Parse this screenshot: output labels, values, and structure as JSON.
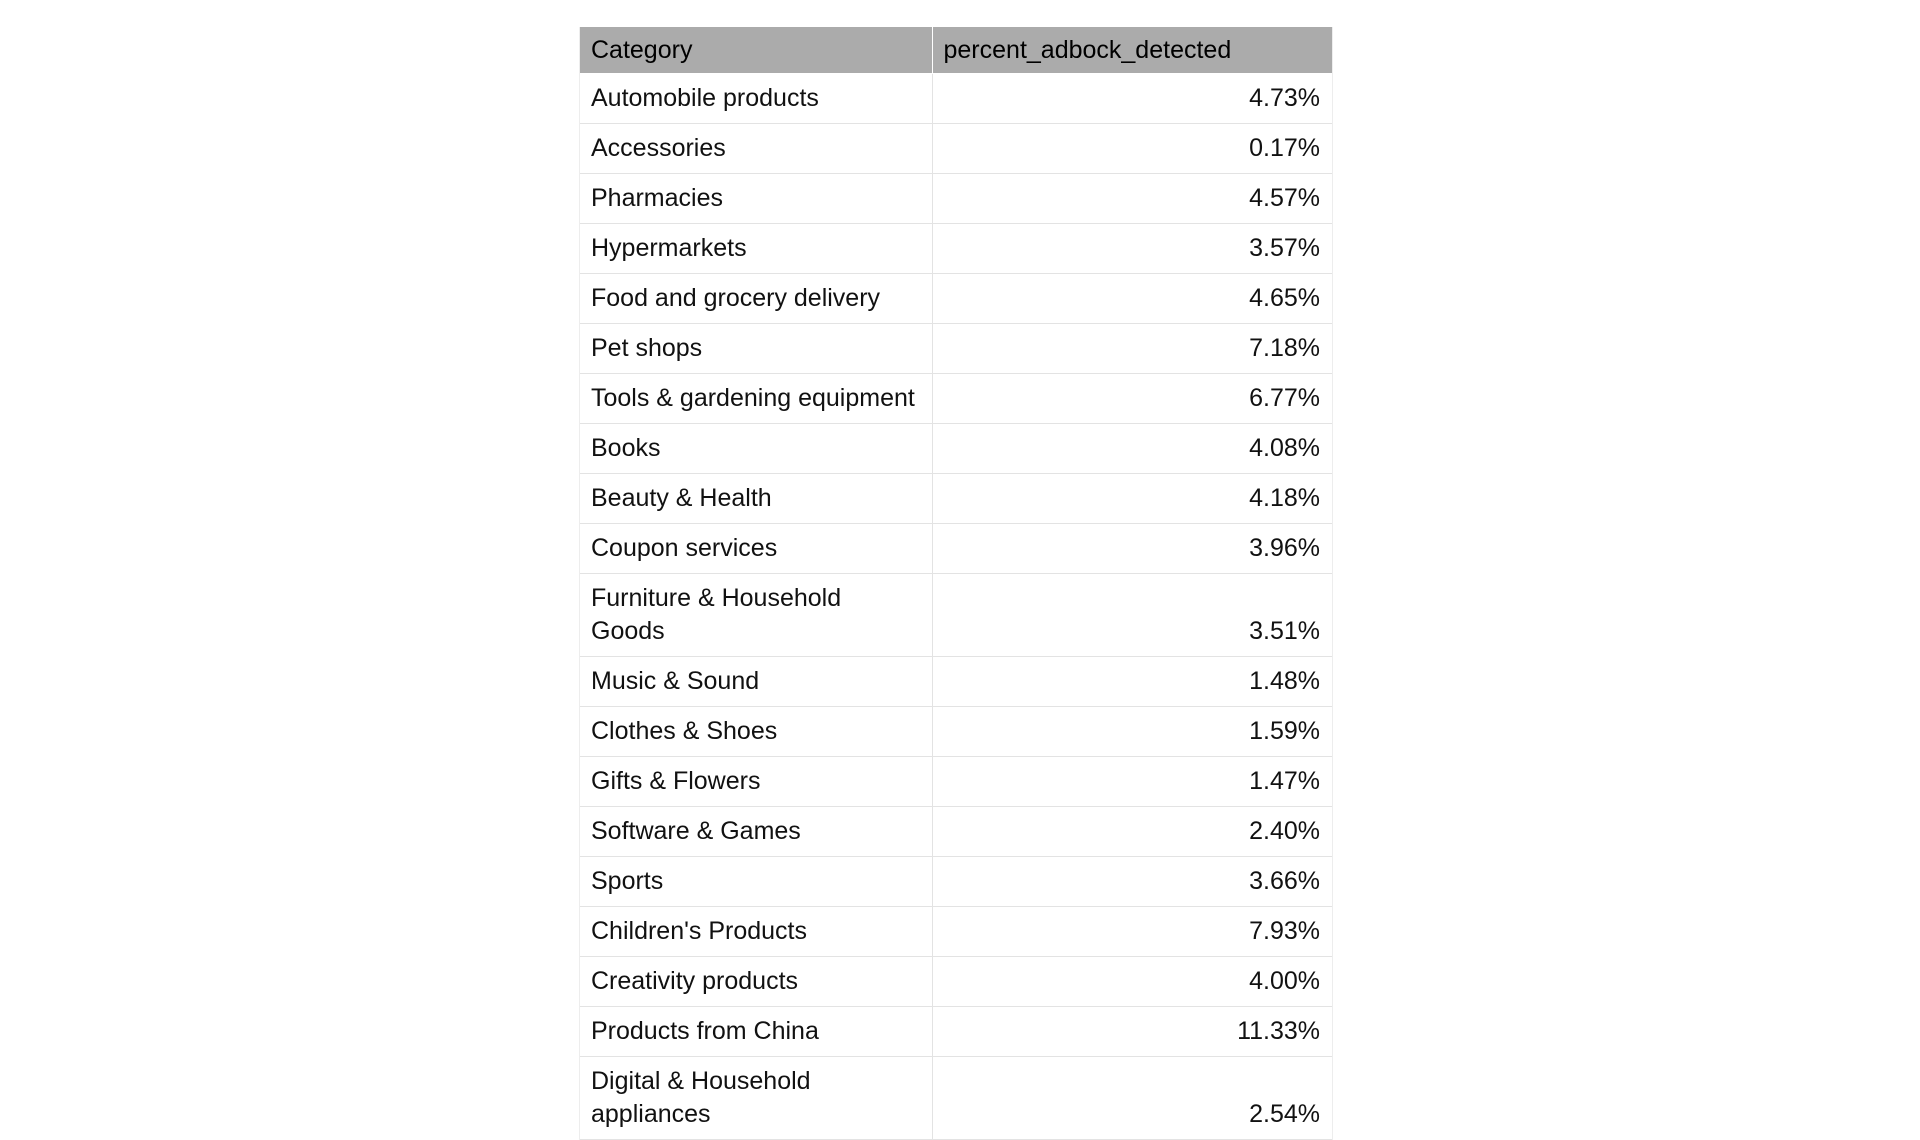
{
  "table": {
    "columns": [
      {
        "key": "category",
        "label": "Category",
        "align": "left"
      },
      {
        "key": "value",
        "label": "percent_adbock_detected",
        "align": "right"
      }
    ],
    "header_background": "#ababab",
    "row_divider_color": "#e3e3e3",
    "background": "#ffffff",
    "rows": [
      {
        "category": "Automobile products",
        "value": "4.73%"
      },
      {
        "category": "Accessories",
        "value": "0.17%"
      },
      {
        "category": "Pharmacies",
        "value": "4.57%"
      },
      {
        "category": "Hypermarkets",
        "value": "3.57%"
      },
      {
        "category": "Food and grocery delivery",
        "value": "4.65%"
      },
      {
        "category": "Pet shops",
        "value": "7.18%"
      },
      {
        "category": "Tools & gardening equipment",
        "value": "6.77%"
      },
      {
        "category": "Books",
        "value": "4.08%"
      },
      {
        "category": "Beauty & Health",
        "value": "4.18%"
      },
      {
        "category": "Coupon services",
        "value": "3.96%"
      },
      {
        "category": "Furniture & Household Goods",
        "value": "3.51%"
      },
      {
        "category": "Music & Sound",
        "value": "1.48%"
      },
      {
        "category": "Clothes & Shoes",
        "value": "1.59%"
      },
      {
        "category": "Gifts & Flowers",
        "value": "1.47%"
      },
      {
        "category": "Software & Games",
        "value": "2.40%"
      },
      {
        "category": "Sports",
        "value": "3.66%"
      },
      {
        "category": "Children's Products",
        "value": "7.93%"
      },
      {
        "category": "Creativity products",
        "value": "4.00%"
      },
      {
        "category": "Products from China",
        "value": "11.33%"
      },
      {
        "category": "Digital & Household appliances",
        "value": "2.54%"
      }
    ]
  },
  "chart_data": {
    "type": "table",
    "title": "",
    "columns": [
      "Category",
      "percent_adbock_detected"
    ],
    "categories": [
      "Automobile products",
      "Accessories",
      "Pharmacies",
      "Hypermarkets",
      "Food and grocery delivery",
      "Pet shops",
      "Tools & gardening equipment",
      "Books",
      "Beauty & Health",
      "Coupon services",
      "Furniture & Household Goods",
      "Music & Sound",
      "Clothes & Shoes",
      "Gifts & Flowers",
      "Software & Games",
      "Sports",
      "Children's Products",
      "Creativity products",
      "Products from China",
      "Digital & Household appliances"
    ],
    "values": [
      4.73,
      0.17,
      4.57,
      3.57,
      4.65,
      7.18,
      6.77,
      4.08,
      4.18,
      3.96,
      3.51,
      1.48,
      1.59,
      1.47,
      2.4,
      3.66,
      7.93,
      4.0,
      11.33,
      2.54
    ],
    "unit": "%",
    "xlabel": "Category",
    "ylabel": "percent_adbock_detected"
  }
}
